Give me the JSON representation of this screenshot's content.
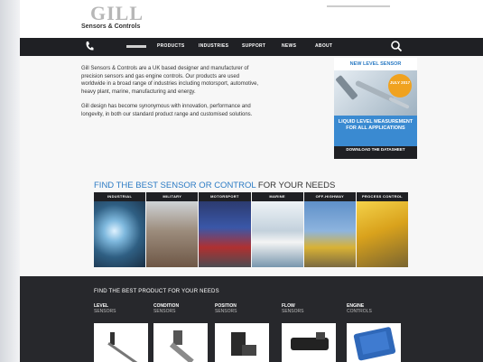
{
  "logo": {
    "mark": "GILL",
    "name": "Sensors & Controls"
  },
  "nav": {
    "items": [
      "PRODUCTS",
      "INDUSTRIES",
      "SUPPORT",
      "NEWS",
      "ABOUT"
    ]
  },
  "intro": {
    "para1": "Gill Sensors & Controls are a UK based designer and manufacturer of precision sensors and gas engine controls. Our products are used worldwide in a broad range of industries including motorsport, automotive, heavy plant, marine, manufacturing and energy.",
    "para2": "Gill design has become synonymous with innovation, performance and longevity, in both our standard product range and customised solutions."
  },
  "promo": {
    "new_label": "NEW LEVEL SENSOR",
    "badge": "JULY 2017",
    "text": "LIQUID LEVEL MEASUREMENT FOR ALL APPLICATIONS",
    "button": "DOWNLOAD THE DATASHEET"
  },
  "find_section": {
    "heading_highlight": "FIND THE BEST SENSOR OR CONTROL",
    "heading_rest": " FOR YOUR NEEDS",
    "categories": [
      "INDUSTRIAL",
      "MILITARY",
      "MOTORSPORT",
      "MARINE",
      "OFF-HIGHWAY",
      "PROCESS CONTROL"
    ]
  },
  "product_section": {
    "title": "FIND THE BEST PRODUCT FOR YOUR NEEDS",
    "products": [
      {
        "name": "LEVEL",
        "sub": "SENSORS"
      },
      {
        "name": "CONDITION",
        "sub": "SENSORS"
      },
      {
        "name": "POSITION",
        "sub": "SENSORS"
      },
      {
        "name": "FLOW",
        "sub": "SENSORS"
      },
      {
        "name": "ENGINE",
        "sub": "CONTROLS"
      }
    ]
  },
  "colors": {
    "accent": "#2c7bc4",
    "nav_bg": "#1f2024",
    "promo_bg": "#3a8ad1",
    "badge": "#f0a21f"
  }
}
